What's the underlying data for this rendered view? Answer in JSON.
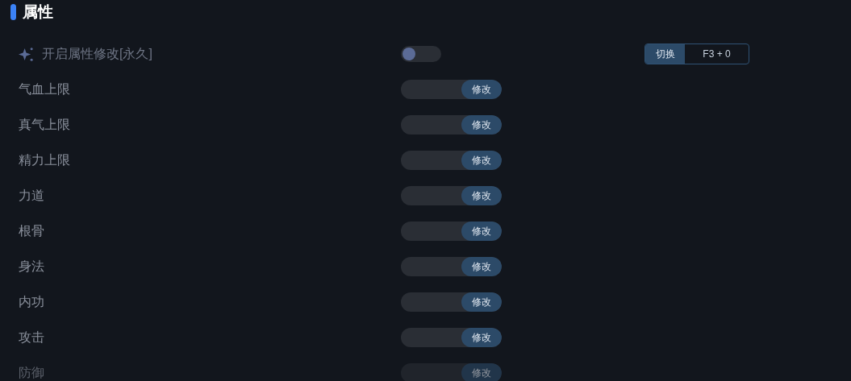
{
  "section": {
    "title": "属性"
  },
  "toggle_row": {
    "label": "开启属性修改[永久]",
    "on": false,
    "hotkey_label": "切换",
    "hotkey": "F3 + 0"
  },
  "rows": [
    {
      "label": "气血上限",
      "button": "修改",
      "faded": false
    },
    {
      "label": "真气上限",
      "button": "修改",
      "faded": false
    },
    {
      "label": "精力上限",
      "button": "修改",
      "faded": false
    },
    {
      "label": "力道",
      "button": "修改",
      "faded": false
    },
    {
      "label": "根骨",
      "button": "修改",
      "faded": false
    },
    {
      "label": "身法",
      "button": "修改",
      "faded": false
    },
    {
      "label": "内功",
      "button": "修改",
      "faded": false
    },
    {
      "label": "攻击",
      "button": "修改",
      "faded": false
    },
    {
      "label": "防御",
      "button": "修改",
      "faded": true
    }
  ]
}
